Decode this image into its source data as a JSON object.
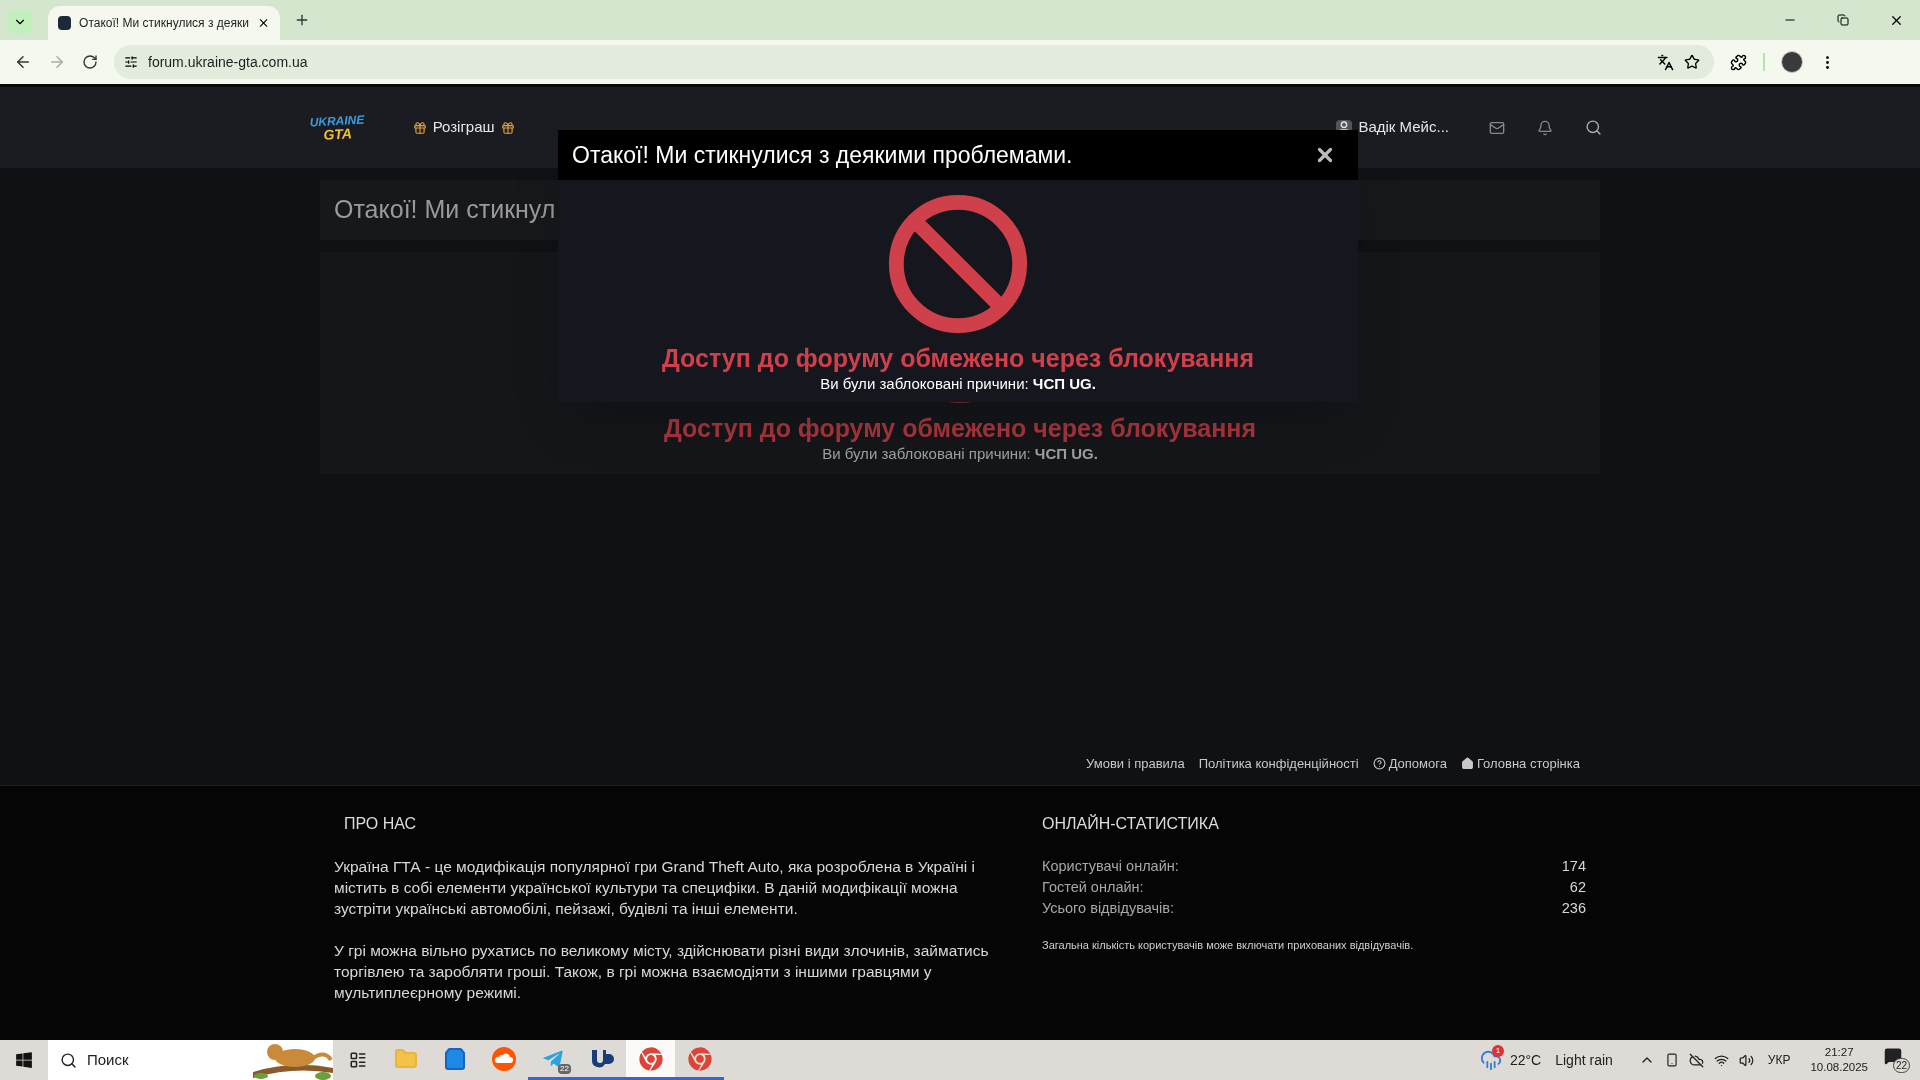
{
  "browser": {
    "tab_title": "Отакої! Ми стикнулися з деяки",
    "url": "forum.ukraine-gta.com.ua"
  },
  "site_header": {
    "logo_lines": [
      "UKRAINE",
      "GTA"
    ],
    "nav": [
      {
        "label": "Розіграш"
      }
    ],
    "user": "Вадік Мейс..."
  },
  "page": {
    "title": "Отакої! Ми стикнул",
    "message": "Доступ до форуму обмежено через блокування",
    "reason": "Ви були заблоковані причини: **ЧСП UG.**"
  },
  "modal": {
    "title": "Отакої! Ми стикнулися з деякими проблемами.",
    "message": "Доступ до форуму обмежено через блокування",
    "reason": "Ви були заблоковані причини: **ЧСП UG.**"
  },
  "footer_links": [
    {
      "label": "Умови і правила",
      "kind": "plain"
    },
    {
      "label": "Політика конфіденційності",
      "kind": "plain"
    },
    {
      "label": "Допомога",
      "kind": "help"
    },
    {
      "label": "Головна сторінка",
      "kind": "home"
    }
  ],
  "about": {
    "title": "ПРО НАС",
    "paragraphs": [
      "Україна ГТА - це модифікація популярної гри Grand Theft Auto, яка розроблена в Україні і містить в собі елементи української культури та специфіки. В даній модифікації можна зустріти українські автомобілі, пейзажі, будівлі та інші елементи.",
      "У грі можна вільно рухатись по великому місту, здійснювати різні види злочинів, займатись торгівлею та заробляти гроші. Також, в грі можна взаємодіяти з іншими гравцями у мультиплеєрному режимі."
    ]
  },
  "stats": {
    "title": "ОНЛАЙН-СТАТИСТИКА",
    "rows": [
      {
        "label": "Користувачі онлайн:",
        "value": "174"
      },
      {
        "label": "Гостей онлайн:",
        "value": "62"
      },
      {
        "label": "Усього відвідувачів:",
        "value": "236"
      }
    ],
    "note": "Загальна кількість користувачів може включати прихованих відвідувачів."
  },
  "taskbar": {
    "search_placeholder": "Поиск",
    "apps": [
      {
        "kind": "folder",
        "open": false,
        "selected": false
      },
      {
        "kind": "store",
        "open": false,
        "selected": false
      },
      {
        "kind": "soundcloud",
        "open": false,
        "selected": false
      },
      {
        "kind": "telegram",
        "open": true,
        "selected": false,
        "badge": "22"
      },
      {
        "kind": "ub",
        "open": true,
        "selected": false
      },
      {
        "kind": "chrome",
        "open": true,
        "selected": true
      },
      {
        "kind": "chrome",
        "open": true,
        "selected": false
      }
    ],
    "weather": {
      "temp": "22°C",
      "text": "Light rain",
      "badge": "1"
    },
    "language": "УКР",
    "time": "21:27",
    "date": "10.08.2025",
    "notifications": "22"
  }
}
